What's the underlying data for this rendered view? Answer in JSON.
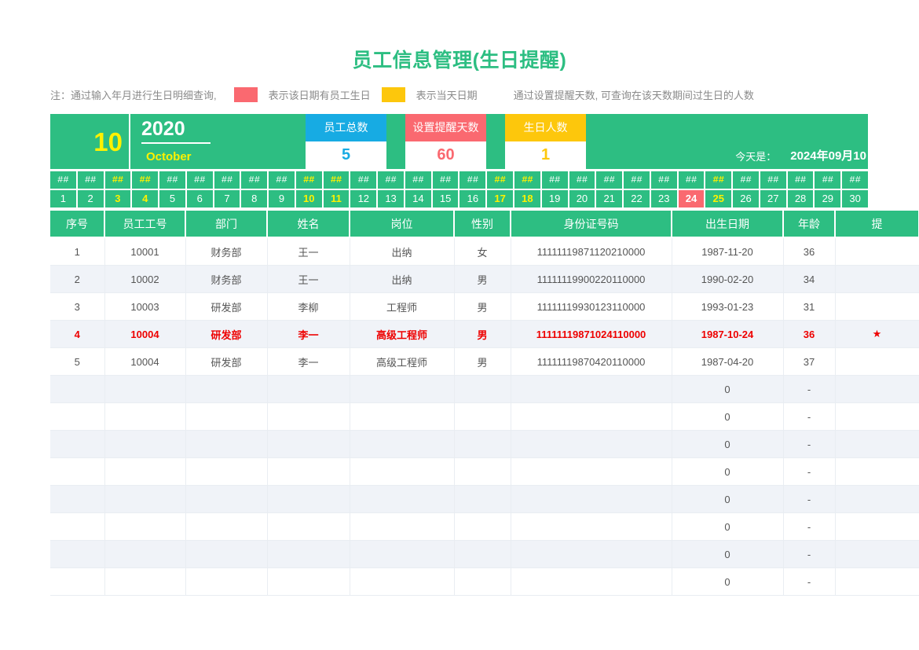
{
  "page": {
    "title": "员工信息管理(生日提醒)",
    "accent_green": "#2DBE82",
    "accent_blue": "#17ABE3",
    "accent_red": "#FA6970",
    "accent_yellow": "#FDC70C"
  },
  "note": {
    "prefix": "注：通过输入年月进行生日明细查询,",
    "red_meaning": "表示该日期有员工生日",
    "yellow_meaning": "表示当天日期",
    "suffix": "通过设置提醒天数, 可查询在该天数期间过生日的人数"
  },
  "banner": {
    "month_number": "10",
    "year": "2020",
    "month_name": "October",
    "today_label": "今天是：",
    "today_value": "2024年09月10",
    "stats": [
      {
        "label": "员工总数",
        "value": "5",
        "color": "blue"
      },
      {
        "label": "设置提醒天数",
        "value": "60",
        "color": "red"
      },
      {
        "label": "生日人数",
        "value": "1",
        "color": "yellow"
      }
    ]
  },
  "calendar": {
    "hash_placeholder": "##",
    "days": [
      {
        "n": "1",
        "weekend": false,
        "birthday": false
      },
      {
        "n": "2",
        "weekend": false,
        "birthday": false
      },
      {
        "n": "3",
        "weekend": true,
        "birthday": false
      },
      {
        "n": "4",
        "weekend": true,
        "birthday": false
      },
      {
        "n": "5",
        "weekend": false,
        "birthday": false
      },
      {
        "n": "6",
        "weekend": false,
        "birthday": false
      },
      {
        "n": "7",
        "weekend": false,
        "birthday": false
      },
      {
        "n": "8",
        "weekend": false,
        "birthday": false
      },
      {
        "n": "9",
        "weekend": false,
        "birthday": false
      },
      {
        "n": "10",
        "weekend": true,
        "birthday": false
      },
      {
        "n": "11",
        "weekend": true,
        "birthday": false
      },
      {
        "n": "12",
        "weekend": false,
        "birthday": false
      },
      {
        "n": "13",
        "weekend": false,
        "birthday": false
      },
      {
        "n": "14",
        "weekend": false,
        "birthday": false
      },
      {
        "n": "15",
        "weekend": false,
        "birthday": false
      },
      {
        "n": "16",
        "weekend": false,
        "birthday": false
      },
      {
        "n": "17",
        "weekend": true,
        "birthday": false
      },
      {
        "n": "18",
        "weekend": true,
        "birthday": false
      },
      {
        "n": "19",
        "weekend": false,
        "birthday": false
      },
      {
        "n": "20",
        "weekend": false,
        "birthday": false
      },
      {
        "n": "21",
        "weekend": false,
        "birthday": false
      },
      {
        "n": "22",
        "weekend": false,
        "birthday": false
      },
      {
        "n": "23",
        "weekend": false,
        "birthday": false
      },
      {
        "n": "24",
        "weekend": false,
        "birthday": true
      },
      {
        "n": "25",
        "weekend": true,
        "birthday": false
      },
      {
        "n": "26",
        "weekend": false,
        "birthday": false
      },
      {
        "n": "27",
        "weekend": false,
        "birthday": false
      },
      {
        "n": "28",
        "weekend": false,
        "birthday": false
      },
      {
        "n": "29",
        "weekend": false,
        "birthday": false
      },
      {
        "n": "30",
        "weekend": false,
        "birthday": false
      }
    ]
  },
  "table": {
    "headers": [
      "序号",
      "员工工号",
      "部门",
      "姓名",
      "岗位",
      "性别",
      "身份证号码",
      "出生日期",
      "年龄",
      "提"
    ],
    "rows": [
      {
        "cells": [
          "1",
          "10001",
          "财务部",
          "王一",
          "出纳",
          "女",
          "11111119871120210000",
          "1987-11-20",
          "36",
          ""
        ],
        "highlight": false
      },
      {
        "cells": [
          "2",
          "10002",
          "财务部",
          "王一",
          "出纳",
          "男",
          "11111119900220110000",
          "1990-02-20",
          "34",
          ""
        ],
        "highlight": false
      },
      {
        "cells": [
          "3",
          "10003",
          "研发部",
          "李柳",
          "工程师",
          "男",
          "11111119930123110000",
          "1993-01-23",
          "31",
          ""
        ],
        "highlight": false
      },
      {
        "cells": [
          "4",
          "10004",
          "研发部",
          "李一",
          "高级工程师",
          "男",
          "11111119871024110000",
          "1987-10-24",
          "36",
          "★"
        ],
        "highlight": true
      },
      {
        "cells": [
          "5",
          "10004",
          "研发部",
          "李一",
          "高级工程师",
          "男",
          "11111119870420110000",
          "1987-04-20",
          "37",
          ""
        ],
        "highlight": false
      },
      {
        "cells": [
          "",
          "",
          "",
          "",
          "",
          "",
          "",
          "0",
          "-",
          ""
        ],
        "highlight": false
      },
      {
        "cells": [
          "",
          "",
          "",
          "",
          "",
          "",
          "",
          "0",
          "-",
          ""
        ],
        "highlight": false
      },
      {
        "cells": [
          "",
          "",
          "",
          "",
          "",
          "",
          "",
          "0",
          "-",
          ""
        ],
        "highlight": false
      },
      {
        "cells": [
          "",
          "",
          "",
          "",
          "",
          "",
          "",
          "0",
          "-",
          ""
        ],
        "highlight": false
      },
      {
        "cells": [
          "",
          "",
          "",
          "",
          "",
          "",
          "",
          "0",
          "-",
          ""
        ],
        "highlight": false
      },
      {
        "cells": [
          "",
          "",
          "",
          "",
          "",
          "",
          "",
          "0",
          "-",
          ""
        ],
        "highlight": false
      },
      {
        "cells": [
          "",
          "",
          "",
          "",
          "",
          "",
          "",
          "0",
          "-",
          ""
        ],
        "highlight": false
      },
      {
        "cells": [
          "",
          "",
          "",
          "",
          "",
          "",
          "",
          "0",
          "-",
          ""
        ],
        "highlight": false
      }
    ]
  }
}
